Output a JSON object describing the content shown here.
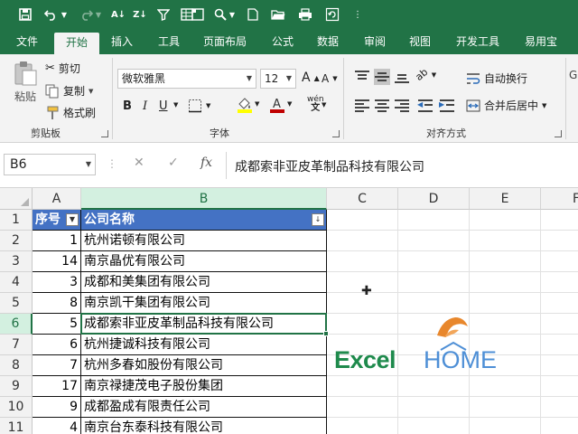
{
  "qat": {
    "icons": [
      "save-icon",
      "undo-icon",
      "undo-dropdown-icon",
      "redo-icon",
      "redo-dropdown-icon",
      "sort-ascending-icon",
      "sort-descending-icon",
      "filter-icon",
      "insert-table-icon",
      "pivot-icon",
      "find-icon",
      "find-dropdown-icon",
      "new-file-icon",
      "open-folder-icon",
      "print-icon",
      "refresh-icon",
      "customize-qat-icon"
    ]
  },
  "tabs": [
    "文件",
    "开始",
    "插入",
    "工具",
    "页面布局",
    "公式",
    "数据",
    "审阅",
    "视图",
    "开发工具",
    "易用宝"
  ],
  "active_tab": "开始",
  "clipboard": {
    "paste": "粘贴",
    "cut": "剪切",
    "copy": "复制",
    "format_painter": "格式刷",
    "label": "剪贴板"
  },
  "font": {
    "name": "微软雅黑",
    "size": "12",
    "bold": "B",
    "italic": "I",
    "underline": "U",
    "grow": "A",
    "shrink": "A",
    "phonetic": "wén",
    "label": "字体",
    "fill_color": "#ffff00",
    "font_color": "#c00000"
  },
  "alignment": {
    "wrap": "自动换行",
    "merge": "合并后居中",
    "label": "对齐方式"
  },
  "formula_bar": {
    "name_box": "B6",
    "fx": "fx",
    "cancel": "✕",
    "enter": "✓",
    "content": "成都索非亚皮革制品科技有限公司"
  },
  "grid": {
    "columns": [
      "A",
      "B",
      "C",
      "D",
      "E",
      "F"
    ],
    "rows": [
      "1",
      "2",
      "3",
      "4",
      "5",
      "6",
      "7",
      "8",
      "9",
      "10",
      "11"
    ],
    "header": [
      "序号",
      "公司名称"
    ],
    "data": [
      [
        "1",
        "杭州诺顿有限公司"
      ],
      [
        "14",
        "南京晶优有限公司"
      ],
      [
        "3",
        "成都和美集团有限公司"
      ],
      [
        "8",
        "南京凯干集团有限公司"
      ],
      [
        "5",
        "成都索非亚皮革制品科技有限公司"
      ],
      [
        "6",
        "杭州捷诚科技有限公司"
      ],
      [
        "7",
        "杭州多春如股份有限公司"
      ],
      [
        "17",
        "南京禄捷茂电子股份集团"
      ],
      [
        "9",
        "成都盈成有限责任公司"
      ],
      [
        "4",
        "南京台东泰科技有限公司"
      ]
    ],
    "active_cell": "B6",
    "table_header_color": "#4472c4"
  },
  "logo": {
    "text_excel": "Excel",
    "text_home": "HOME",
    "excel_color": "#1e8a4c",
    "home_color": "#4e8fd6",
    "mark_color": "#e8872c"
  },
  "colors": {
    "ribbon_green": "#217346"
  }
}
